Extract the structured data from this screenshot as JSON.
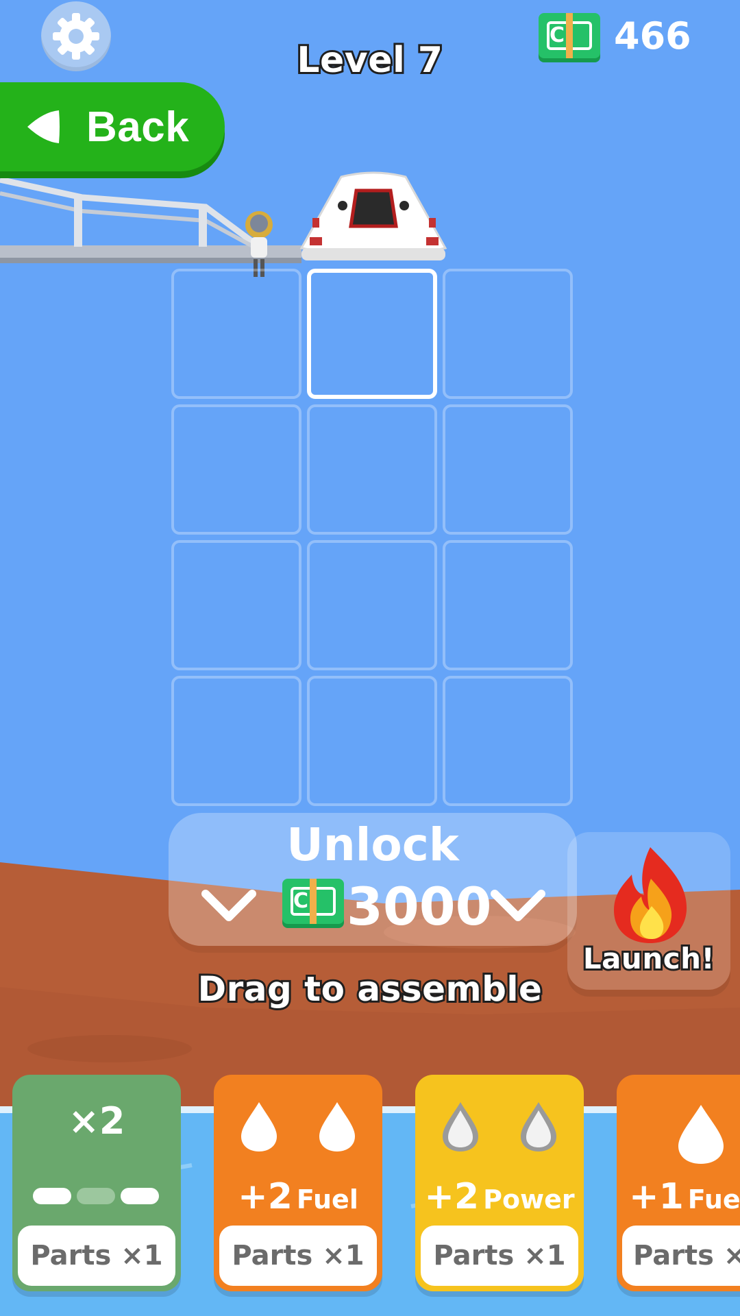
{
  "header": {
    "level_title": "Level 7",
    "cash_amount": "466",
    "cash_symbol": "C"
  },
  "back_button": {
    "label": "Back"
  },
  "unlock": {
    "title": "Unlock",
    "price": "3000",
    "cash_symbol": "C"
  },
  "launch_button": {
    "label": "Launch!"
  },
  "hint_text": "Drag to assemble",
  "cards": [
    {
      "title": "×2",
      "bonus_amount": "",
      "bonus_label": "",
      "footer": "Parts ×1",
      "color": "#6aa86d",
      "icon": "progress-dots-icon"
    },
    {
      "title": "",
      "bonus_amount": "+2",
      "bonus_label": "Fuel",
      "footer": "Parts ×1",
      "color": "#f28020",
      "icon": "fuel-drop-icon"
    },
    {
      "title": "",
      "bonus_amount": "+2",
      "bonus_label": "Power",
      "footer": "Parts ×1",
      "color": "#f6c31e",
      "icon": "power-drop-icon"
    },
    {
      "title": "",
      "bonus_amount": "+1",
      "bonus_label": "Fue",
      "footer": "Parts ×",
      "color": "#f28020",
      "icon": "fuel-drop-icon"
    }
  ],
  "colors": {
    "sky": "#65a4f8",
    "ground": "#b65d37",
    "water": "#63b7f5",
    "back_button": "#24b21a",
    "cash_green": "#25c168"
  },
  "grid": {
    "rows": 4,
    "columns": 3,
    "active_cell": "row 1, column 2"
  }
}
